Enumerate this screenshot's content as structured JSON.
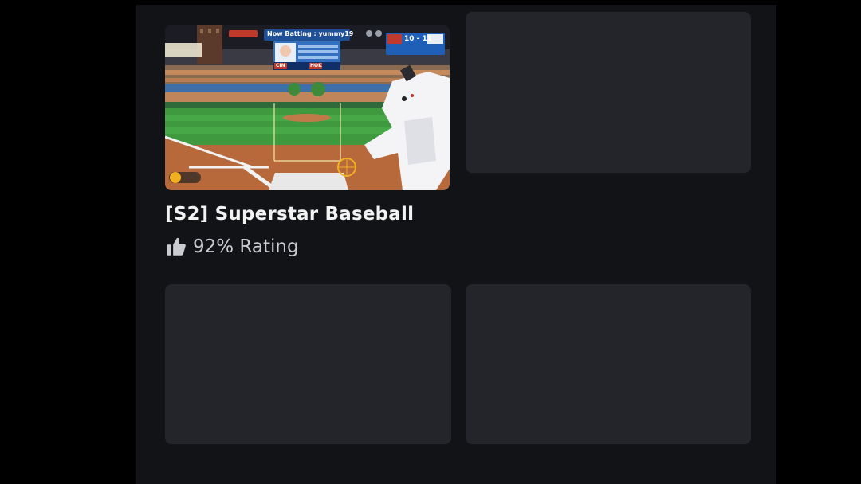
{
  "games": [
    {
      "title": "[S2] Superstar Baseball",
      "rating": "92% Rating",
      "thumbnail": {
        "now_batting": "Now Batting : yummy19",
        "away_team": "CIN",
        "home_team": "HOK",
        "score": "10 - 11"
      }
    }
  ],
  "placeholders": [
    "card-2",
    "card-3",
    "card-4"
  ],
  "icons": {
    "rating": "thumbs-up-icon"
  },
  "colors": {
    "background": "#121316",
    "card": "#23252b",
    "text": "#f2f2f2",
    "muted": "#c9cbd1"
  }
}
